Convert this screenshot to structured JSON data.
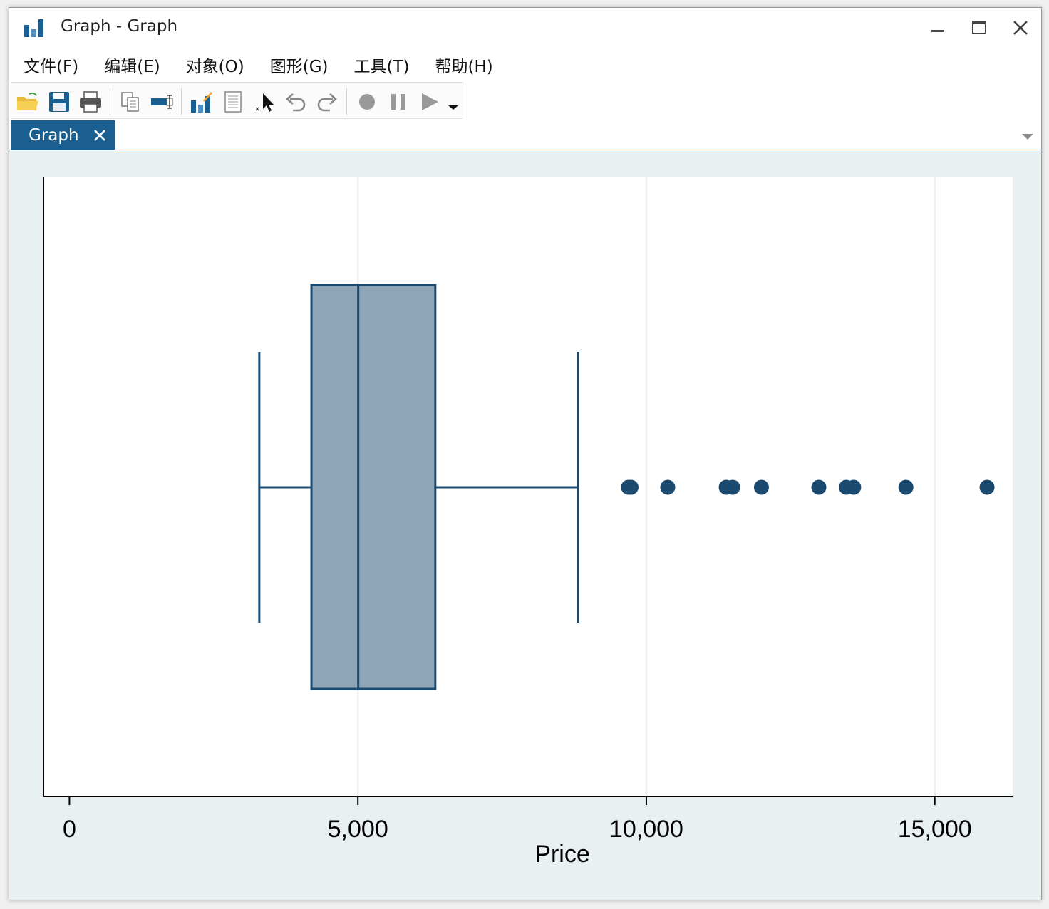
{
  "window": {
    "title": "Graph - Graph"
  },
  "menu": [
    "文件(F)",
    "编辑(E)",
    "对象(O)",
    "图形(G)",
    "工具(T)",
    "帮助(H)"
  ],
  "toolbar": {
    "icons": [
      "open-folder-icon",
      "save-icon",
      "print-icon",
      "copy-icon",
      "rename-icon",
      "graph-editor-icon",
      "properties-icon",
      "pointer-icon",
      "undo-icon",
      "redo-icon",
      "record-icon",
      "pause-icon",
      "play-icon",
      "dropdown-icon"
    ]
  },
  "tabs": [
    {
      "label": "Graph",
      "active": true
    }
  ],
  "colors": {
    "accent": "#1a5f8f",
    "box_fill": "#8fa5b8",
    "box_stroke": "#1a4a70",
    "plot_bg": "#e9f0f2"
  },
  "chart_data": {
    "type": "box",
    "orientation": "horizontal",
    "xlabel": "Price",
    "xlim": [
      -450,
      16350
    ],
    "xticks": [
      0,
      5000,
      10000,
      15000
    ],
    "xtick_labels": [
      "0",
      "5,000",
      "10,000",
      "15,000"
    ],
    "grid": "vertical",
    "box": {
      "whisker_low": 3291,
      "q1": 4195,
      "median": 5006,
      "q3": 6342,
      "whisker_high": 8814
    },
    "outliers": [
      9690,
      9735,
      10371,
      11385,
      11497,
      11995,
      12990,
      13466,
      13594,
      14500,
      15906
    ]
  }
}
